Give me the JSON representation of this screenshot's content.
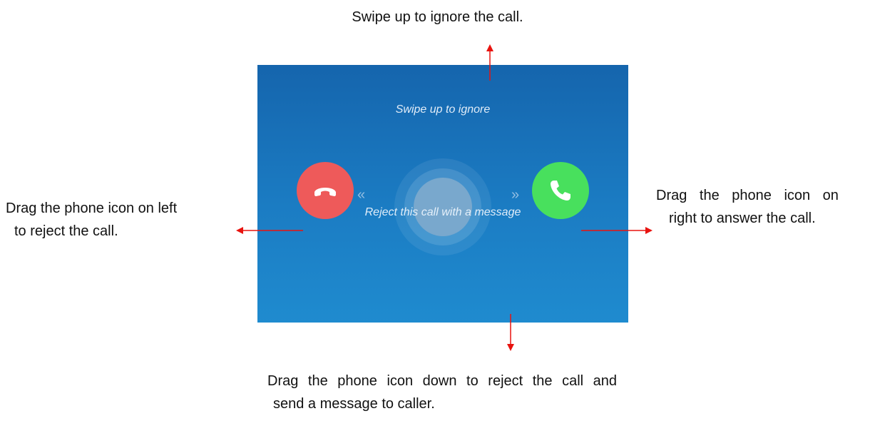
{
  "captions": {
    "top": "Swipe up to ignore the call.",
    "left_line1": "Drag the phone icon on left",
    "left_line2": "to reject the call.",
    "right_line1": "Drag the phone icon on",
    "right_line2": "right to answer the call.",
    "bottom_line1": "Drag the phone icon down to reject the call and",
    "bottom_line2": "send a message to caller."
  },
  "screen": {
    "ignore_hint": "Swipe up to ignore",
    "message_hint": "Reject this call with a message",
    "left_chevron": "«",
    "right_chevron": "»"
  },
  "colors": {
    "screen_top": "#1565ad",
    "screen_bottom": "#1f8bcf",
    "reject": "#ee5a5a",
    "answer": "#48e05d",
    "annotation_arrow": "#e8130f"
  },
  "icons": {
    "reject": "phone-hangup-icon",
    "answer": "phone-answer-icon",
    "handle": "incoming-call-handle"
  }
}
